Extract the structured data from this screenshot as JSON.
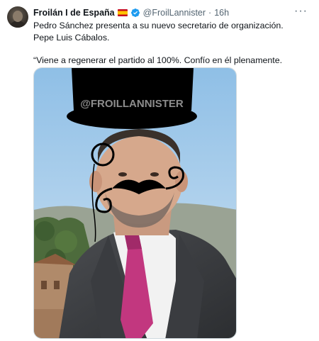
{
  "tweet": {
    "author_name": "Froilán I de España",
    "handle": "@FroilLannister",
    "separator": "·",
    "time": "16h",
    "more_label": "···",
    "text_line1": "Pedro Sánchez presenta a su nuevo secretario de organización. Pepe Luis Cábalos.",
    "text_line2": "“Viene a regenerar el partido al 100%. Confío en él plenamente."
  },
  "media": {
    "watermark": "@FROILLANNISTER"
  },
  "icons": {
    "flag": "spain-flag-icon",
    "verified": "verified-badge-icon",
    "more": "more-options-icon"
  },
  "colors": {
    "verified": "#1d9bf0",
    "secondary_text": "#536471",
    "tie": "#c2377f"
  }
}
